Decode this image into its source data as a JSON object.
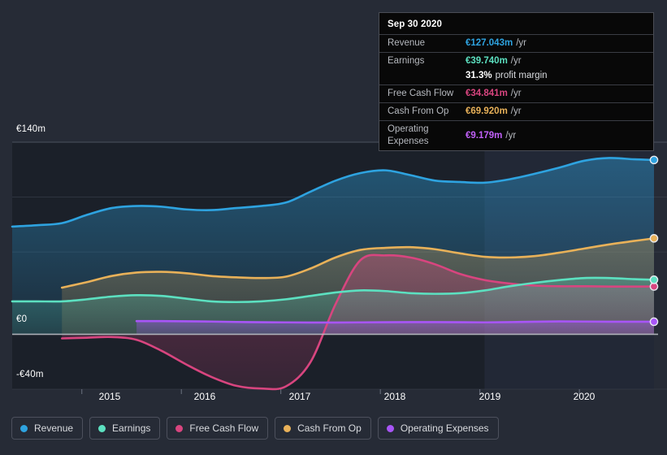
{
  "colors": {
    "background": "#262b36",
    "plot_band": "#1b2029",
    "plot_band_highlight": "#222836",
    "zero_line": "#b9bcc2",
    "gridline": "#454b57",
    "revenue": "#2ea3e0",
    "earnings": "#5ce0c0",
    "free_cash_flow": "#d8457f",
    "cash_from_op": "#e8b159",
    "operating_expenses": "#a855f7"
  },
  "tooltip": {
    "date": "Sep 30 2020",
    "rows": [
      {
        "label": "Revenue",
        "value": "€127.043m",
        "unit": "/yr",
        "color": "#2ea3e0",
        "sub": ""
      },
      {
        "label": "Earnings",
        "value": "€39.740m",
        "unit": "/yr",
        "color": "#5ce0c0",
        "sub": ""
      },
      {
        "label": "",
        "value": "31.3%",
        "unit": "",
        "color": "#ffffff",
        "sub": "profit margin"
      },
      {
        "label": "Free Cash Flow",
        "value": "€34.841m",
        "unit": "/yr",
        "color": "#d8457f",
        "sub": ""
      },
      {
        "label": "Cash From Op",
        "value": "€69.920m",
        "unit": "/yr",
        "color": "#e8b159",
        "sub": ""
      },
      {
        "label": "Operating Expenses",
        "value": "€9.179m",
        "unit": "/yr",
        "color": "#c060f8",
        "sub": ""
      }
    ]
  },
  "legend": {
    "items": [
      {
        "label": "Revenue",
        "color": "#2ea3e0"
      },
      {
        "label": "Earnings",
        "color": "#5ce0c0"
      },
      {
        "label": "Free Cash Flow",
        "color": "#d8457f"
      },
      {
        "label": "Cash From Op",
        "color": "#e8b159"
      },
      {
        "label": "Operating Expenses",
        "color": "#a855f7"
      }
    ]
  },
  "chart_data": {
    "type": "area",
    "title": "",
    "xlabel": "",
    "ylabel": "",
    "ylim": [
      -40,
      140
    ],
    "ytick_labels": [
      "€140m",
      "€0",
      "-€40m"
    ],
    "ytick_values": [
      140,
      0,
      -40
    ],
    "gridlines": [
      140,
      100,
      60,
      0,
      -40
    ],
    "grid": true,
    "legend_position": "bottom-left",
    "xtick_labels": [
      "2015",
      "2016",
      "2017",
      "2018",
      "2019",
      "2020"
    ],
    "xtick_values": [
      2015,
      2016,
      2017,
      2018,
      2019,
      2020
    ],
    "x_range": [
      2014.3,
      2020.75
    ],
    "currency": "EUR",
    "units": "millions",
    "highlight_region": {
      "from": 2019.05,
      "to": 2020.75,
      "note": "analyst estimate band"
    },
    "series": [
      {
        "name": "Revenue",
        "color": "#2ea3e0",
        "x": [
          2014.3,
          2014.55,
          2014.8,
          2015.05,
          2015.3,
          2015.55,
          2015.8,
          2016.05,
          2016.3,
          2016.55,
          2016.8,
          2017.05,
          2017.3,
          2017.55,
          2017.8,
          2018.05,
          2018.3,
          2018.55,
          2018.8,
          2019.05,
          2019.3,
          2019.55,
          2019.8,
          2020.05,
          2020.3,
          2020.55,
          2020.75
        ],
        "values": [
          78.5,
          79.5,
          81.0,
          87.0,
          92.0,
          93.5,
          93.0,
          91.0,
          90.5,
          92.0,
          93.5,
          96.0,
          104.0,
          112.0,
          117.5,
          119.5,
          116.0,
          112.0,
          111.0,
          110.5,
          113.0,
          117.0,
          121.5,
          126.5,
          128.5,
          127.5,
          127.043
        ]
      },
      {
        "name": "Earnings",
        "color": "#5ce0c0",
        "x": [
          2014.3,
          2014.55,
          2014.8,
          2015.05,
          2015.3,
          2015.55,
          2015.8,
          2016.05,
          2016.3,
          2016.55,
          2016.8,
          2017.05,
          2017.3,
          2017.55,
          2017.8,
          2018.05,
          2018.3,
          2018.55,
          2018.8,
          2019.05,
          2019.3,
          2019.55,
          2019.8,
          2020.05,
          2020.3,
          2020.55,
          2020.75
        ],
        "values": [
          24.0,
          24.0,
          24.0,
          25.5,
          27.5,
          28.5,
          28.0,
          26.0,
          24.0,
          23.5,
          24.0,
          25.5,
          28.0,
          30.5,
          32.0,
          31.5,
          30.0,
          29.5,
          30.0,
          32.0,
          35.0,
          37.5,
          39.5,
          41.0,
          41.0,
          40.2,
          39.74
        ]
      },
      {
        "name": "Free Cash Flow",
        "color": "#d8457f",
        "x": [
          2014.8,
          2015.05,
          2015.3,
          2015.55,
          2015.8,
          2016.05,
          2016.3,
          2016.55,
          2016.8,
          2017.05,
          2017.3,
          2017.55,
          2017.8,
          2018.05,
          2018.3,
          2018.55,
          2018.8,
          2019.05,
          2019.3,
          2019.55,
          2019.8,
          2020.05,
          2020.3,
          2020.55,
          2020.75
        ],
        "values": [
          -3.0,
          -2.5,
          -2.0,
          -4.0,
          -12.0,
          -22.0,
          -31.0,
          -37.5,
          -39.5,
          -38.0,
          -20.0,
          22.0,
          54.0,
          57.5,
          56.0,
          51.0,
          44.0,
          39.5,
          37.0,
          35.5,
          35.0,
          35.0,
          34.8,
          34.8,
          34.841
        ]
      },
      {
        "name": "Cash From Op",
        "color": "#e8b159",
        "x": [
          2014.8,
          2015.05,
          2015.3,
          2015.55,
          2015.8,
          2016.05,
          2016.3,
          2016.55,
          2016.8,
          2017.05,
          2017.3,
          2017.55,
          2017.8,
          2018.05,
          2018.3,
          2018.55,
          2018.8,
          2019.05,
          2019.3,
          2019.55,
          2019.8,
          2020.05,
          2020.3,
          2020.55,
          2020.75
        ],
        "values": [
          34.0,
          38.0,
          42.5,
          45.0,
          45.5,
          44.5,
          42.5,
          41.5,
          41.0,
          42.0,
          48.0,
          56.0,
          61.5,
          63.0,
          63.5,
          62.0,
          59.0,
          56.5,
          56.0,
          57.0,
          59.5,
          62.5,
          65.5,
          68.0,
          69.92
        ]
      },
      {
        "name": "Operating Expenses",
        "color": "#a855f7",
        "x": [
          2015.55,
          2015.8,
          2016.05,
          2016.3,
          2016.55,
          2016.8,
          2017.05,
          2017.3,
          2017.55,
          2017.8,
          2018.05,
          2018.3,
          2018.55,
          2018.8,
          2019.05,
          2019.3,
          2019.55,
          2019.8,
          2020.05,
          2020.3,
          2020.55,
          2020.75
        ],
        "values": [
          9.6,
          9.6,
          9.5,
          9.3,
          9.0,
          8.8,
          8.7,
          8.6,
          8.6,
          8.7,
          8.8,
          8.9,
          8.9,
          8.8,
          8.7,
          8.9,
          9.2,
          9.4,
          9.3,
          9.2,
          9.2,
          9.179
        ]
      }
    ]
  }
}
